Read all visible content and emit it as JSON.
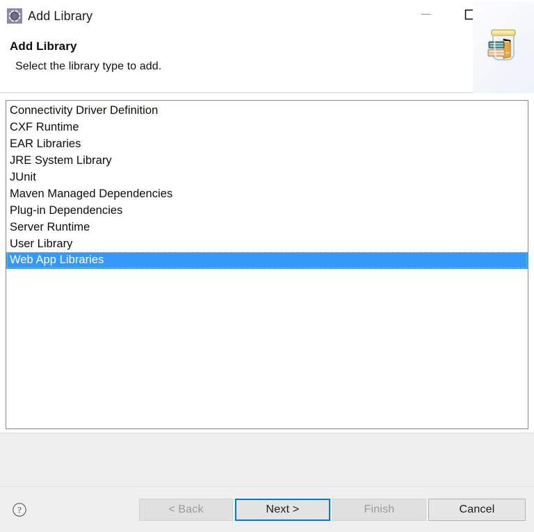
{
  "window": {
    "title": "Add Library",
    "icon": "eclipse-gear-icon",
    "controls": {
      "minimize": "minimize-icon",
      "maximize": "maximize-icon",
      "close": "close-icon"
    }
  },
  "header": {
    "title": "Add Library",
    "description": "Select the library type to add.",
    "banner_icon": "library-jar-books-icon"
  },
  "library_list": {
    "selected_index": 9,
    "items": [
      "Connectivity Driver Definition",
      "CXF Runtime",
      "EAR Libraries",
      "JRE System Library",
      "JUnit",
      "Maven Managed Dependencies",
      "Plug-in Dependencies",
      "Server Runtime",
      "User Library",
      "Web App Libraries"
    ]
  },
  "footer": {
    "help_icon": "help-question-icon",
    "buttons": {
      "back": "< Back",
      "next": "Next >",
      "finish": "Finish",
      "cancel": "Cancel"
    }
  },
  "colors": {
    "selection_blue": "#3399fb",
    "focus_blue": "#0078d7",
    "button_face": "#e1e1e1",
    "panel_gray": "#efefef",
    "disabled_text": "#9a9a9a"
  }
}
